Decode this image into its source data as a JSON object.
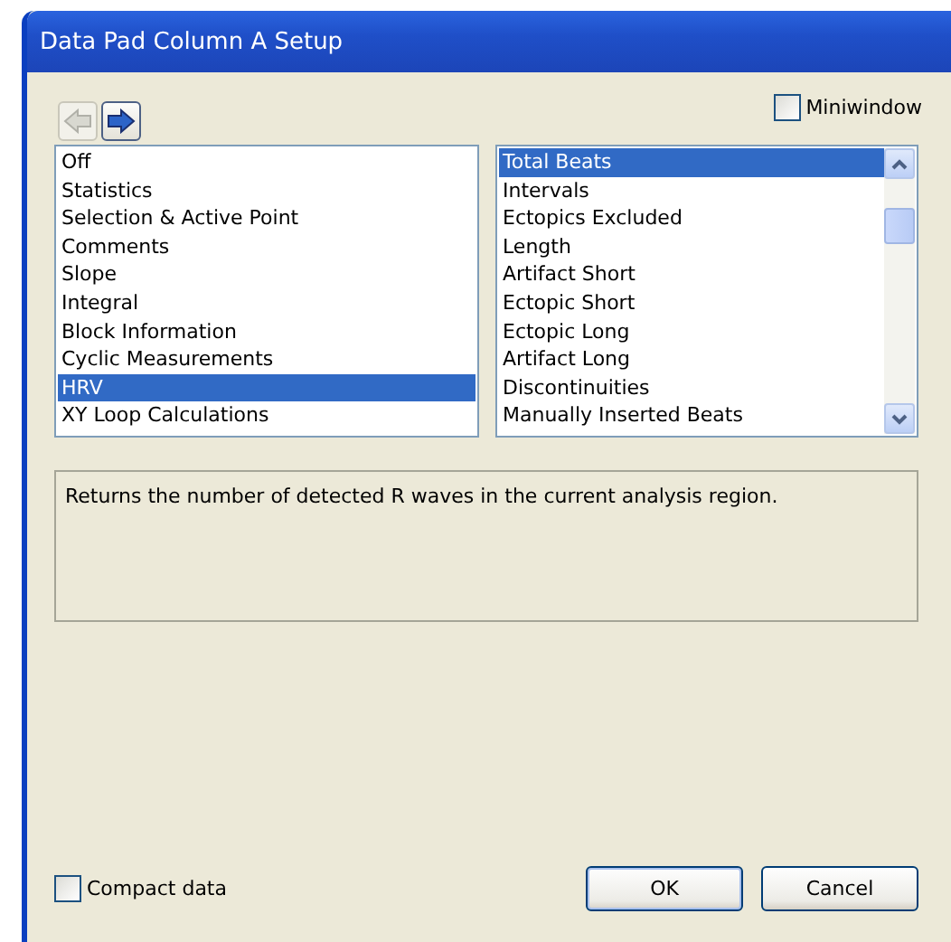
{
  "window": {
    "title": "Data Pad Column A Setup"
  },
  "nav_buttons": [
    {
      "kind": "back",
      "disabled": true
    },
    {
      "kind": "forward",
      "disabled": false
    }
  ],
  "miniwindow": {
    "label": "Miniwindow",
    "checked": false
  },
  "categories": [
    {
      "label": "Off",
      "selected": false
    },
    {
      "label": "Statistics",
      "selected": false
    },
    {
      "label": "Selection & Active Point",
      "selected": false
    },
    {
      "label": "Comments",
      "selected": false
    },
    {
      "label": "Slope",
      "selected": false
    },
    {
      "label": "Integral",
      "selected": false
    },
    {
      "label": "Block Information",
      "selected": false
    },
    {
      "label": "Cyclic Measurements",
      "selected": false
    },
    {
      "label": "HRV",
      "selected": true
    },
    {
      "label": "XY Loop Calculations",
      "selected": false
    }
  ],
  "measurements": [
    {
      "label": "Total Beats",
      "selected": true
    },
    {
      "label": "Intervals",
      "selected": false
    },
    {
      "label": "Ectopics Excluded",
      "selected": false
    },
    {
      "label": "Length",
      "selected": false
    },
    {
      "label": "Artifact Short",
      "selected": false
    },
    {
      "label": "Ectopic Short",
      "selected": false
    },
    {
      "label": "Ectopic Long",
      "selected": false
    },
    {
      "label": "Artifact Long",
      "selected": false
    },
    {
      "label": "Discontinuities",
      "selected": false
    },
    {
      "label": "Manually Inserted Beats",
      "selected": false
    }
  ],
  "description": "Returns the number of detected R waves in the current analysis region.",
  "compact_data": {
    "label": "Compact data",
    "checked": false
  },
  "buttons": [
    {
      "label": "OK",
      "default": true
    },
    {
      "label": "Cancel",
      "default": false
    }
  ]
}
